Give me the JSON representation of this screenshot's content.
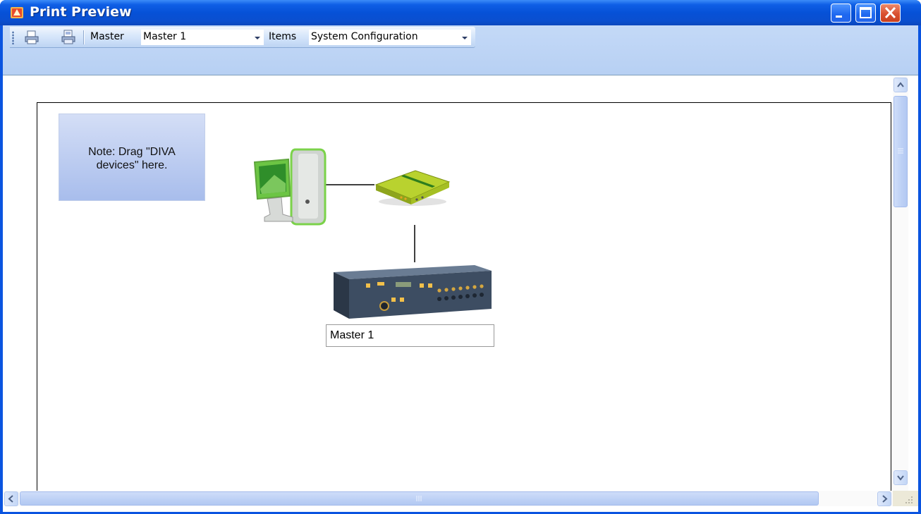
{
  "window": {
    "title": "Print Preview",
    "icon": "app-icon",
    "buttons": [
      "minimize-icon",
      "maximize-icon",
      "close-icon"
    ]
  },
  "toolbar": {
    "print_icon": "printer-icon",
    "page_setup_icon": "page-setup-printer-icon",
    "master_label": "Master",
    "master_value": "Master 1",
    "items_label": "Items",
    "items_value": "System Configuration"
  },
  "diagram": {
    "note_text": "Note: Drag \"DIVA\ndevices\" here.",
    "devices": [
      {
        "name": "computer",
        "icon": "computer-icon"
      },
      {
        "name": "network-switch",
        "icon": "switch-icon"
      },
      {
        "name": "master-unit",
        "icon": "master-device-icon",
        "label": "Master 1"
      }
    ]
  },
  "colors": {
    "titlebar": "#0651d7",
    "toolbar": "#c4d9f7",
    "note_fill": "#bccbf0"
  }
}
